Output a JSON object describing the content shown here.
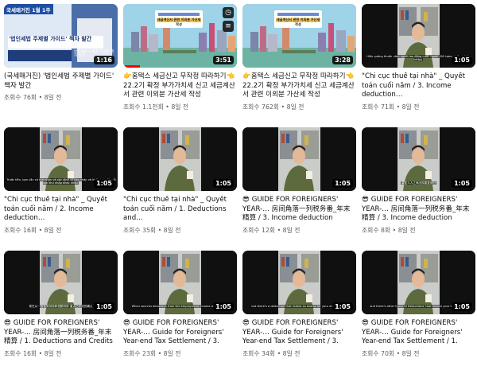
{
  "videos": [
    {
      "title": "(국세매거진) '법인세법 주제별 가이드' 책자 발간",
      "views": "조회수 76회",
      "age": "8일 전",
      "duration": "1:16",
      "thumb": "banner",
      "banner_small": "국세매거진 1월 1주",
      "banner_big": "'법인세법 주제별 가이드' 책자 발간",
      "banner_side": "법인세법 주제별 가이드 책자 발간"
    },
    {
      "title": "👉홈택스 세금신고 무작정 따라하기👈 22.2기 확정 부가가치세 신고 세금계산서 관련 이외분 가산세 작성",
      "views": "조회수 1.1천회",
      "age": "8일 전",
      "duration": "3:51",
      "thumb": "city",
      "watched": 0.15,
      "caption": "세금계산서 관련 이외분 가산세 작성"
    },
    {
      "title": "👉홈택스 세금신고 무작정 따라하기👈 22.2기 확정 부가가치세 신고 세금계산서 관련 이외분 가산세 작성",
      "views": "조회수 762회",
      "age": "8일 전",
      "duration": "3:28",
      "thumb": "city",
      "caption": "세금계산서 관련 이외분 가산세 작성"
    },
    {
      "title": "\"Chi cục thuế tại nhà\" _ Quyết toán cuối năm / 3. Income deduction…",
      "views": "조회수 71회",
      "age": "8일 전",
      "duration": "1:05",
      "thumb": "person",
      "subtitle": "Hiếu quảng thuần năm người lao động nước ngoài (Số lượng khấu trừ thu nhập)"
    },
    {
      "title": "\"Chi cục thuế tại nhà\" _ Quyết toán cuối năm / 2. Income deduction…",
      "views": "조회수 16회",
      "age": "8일 전",
      "duration": "1:05",
      "thumb": "person",
      "subtitle": "Trước tiên, bạn cần có thể nhận và xác định số thu nhập và khấu trừ với mỗi loại thu nhập khác nhau"
    },
    {
      "title": "\"Chi cục thuế tại nhà\" _ Quyết toán cuối năm / 1. Deductions and…",
      "views": "조회수 35회",
      "age": "8일 전",
      "duration": "1:05",
      "thumb": "person",
      "subtitle": ""
    },
    {
      "title": "😎 GUIDE FOR FOREIGNERS' YEAR-… 房间角落一列税务番_年末精算 / 3. Income deduction (personal…",
      "views": "조회수 12회",
      "age": "8일 전",
      "duration": "1:05",
      "thumb": "person",
      "subtitle": ""
    },
    {
      "title": "😎 GUIDE FOR FOREIGNERS' YEAR-… 房间角落一列税务番_年末精算 / 3. Income deduction (personal…",
      "views": "조회수 8회",
      "age": "8일 전",
      "duration": "1:05",
      "thumb": "person",
      "subtitle": "重复人人之间出现重复部分"
    },
    {
      "title": "😎 GUIDE FOR FOREIGNERS' YEAR-… 房间角落一列税务番_年末精算 / 1. Deductions and Credits for…",
      "views": "조회수 16회",
      "age": "8일 전",
      "duration": "1:05",
      "thumb": "person",
      "subtitle": "现在从一般各类扣除和税额扣除 重点已完成的确认"
    },
    {
      "title": "😎 GUIDE FOR FOREIGNERS' YEAR-… Guide for Foreigners' Year-end Tax Settlement / 3. Income deductio…",
      "views": "조회수 23회",
      "age": "8일 전",
      "duration": "1:05",
      "thumb": "person",
      "subtitle": "When sources deduction from the employment income are overlu..."
    },
    {
      "title": "😎 GUIDE FOR FOREIGNERS' YEAR-… Guide for Foreigners' Year-end Tax Settlement / 3. Income deductio…",
      "views": "조회수 34회",
      "age": "8일 전",
      "duration": "1:05",
      "thumb": "person",
      "subtitle": "but there's a deduction that makes so exams for your end tax with"
    },
    {
      "title": "😎 GUIDE FOR FOREIGNERS' YEAR-… Guide for Foreigners' Year-end Tax Settlement / 1. Deductions and…",
      "views": "조회수 70회",
      "age": "8일 전",
      "duration": "1:05",
      "thumb": "person",
      "subtitle": "and there's other types of Deductions' that reduce your taxable in..."
    }
  ],
  "colors": {
    "progress": "#ff0000",
    "meta": "#606060"
  }
}
